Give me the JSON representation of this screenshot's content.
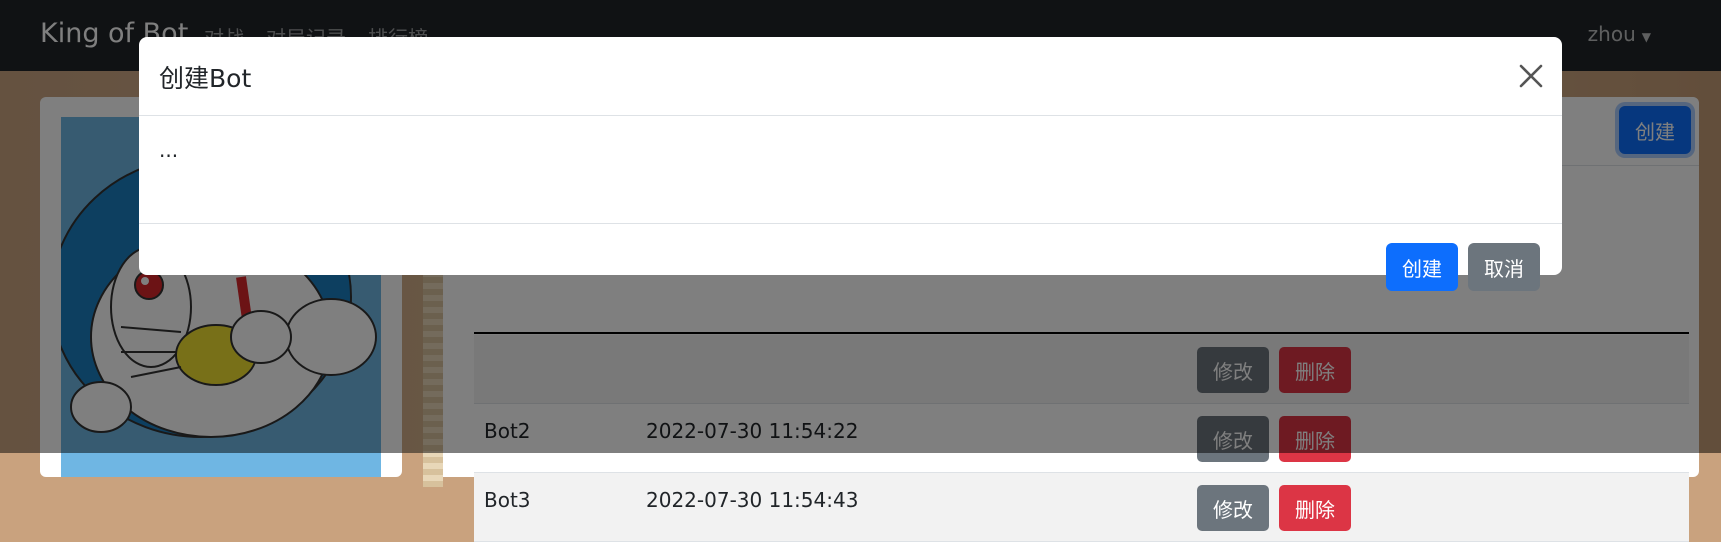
{
  "navbar": {
    "brand": "King of Bot",
    "links": [
      "对战",
      "对局记录",
      "排行榜"
    ],
    "user": "zhou"
  },
  "bots_panel": {
    "create_label": "创建",
    "rows": [
      {
        "name": "",
        "created": "",
        "edit_label": "修改",
        "delete_label": "删除"
      },
      {
        "name": "Bot2",
        "created": "2022-07-30 11:54:22",
        "edit_label": "修改",
        "delete_label": "删除"
      },
      {
        "name": "Bot3",
        "created": "2022-07-30 11:54:43",
        "edit_label": "修改",
        "delete_label": "删除"
      }
    ]
  },
  "modal": {
    "title": "创建Bot",
    "body": "...",
    "create_label": "创建",
    "cancel_label": "取消"
  },
  "colors": {
    "primary": "#0d6efd",
    "secondary": "#6c757d",
    "danger": "#dc3545",
    "navbar": "#212529"
  }
}
